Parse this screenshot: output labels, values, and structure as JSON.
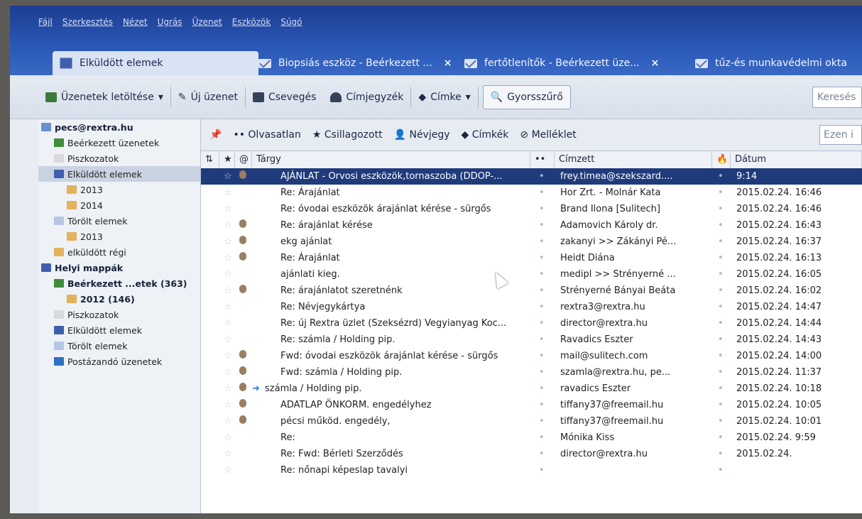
{
  "menu": [
    "Fájl",
    "Szerkesztés",
    "Nézet",
    "Ugrás",
    "Üzenet",
    "Eszközök",
    "Súgó"
  ],
  "tabs": [
    {
      "label": "Elküldött elemek",
      "closable": false
    },
    {
      "label": "Biopsiás eszköz - Beérkezett ...",
      "closable": true
    },
    {
      "label": "fertőtlenítők - Beérkezett üze...",
      "closable": true
    },
    {
      "label": "tűz-és munkavédelmi okta",
      "closable": false
    }
  ],
  "toolbar": {
    "get_messages": "Üzenetek letöltése",
    "new_message": "Új üzenet",
    "chat": "Csevegés",
    "address_book": "Címjegyzék",
    "tag": "Címke",
    "quick_filter": "Gyorsszűrő",
    "search_placeholder": "Keresés"
  },
  "sidebar": {
    "items": [
      {
        "label": "pecs@rextra.hu",
        "bold": true,
        "indent": 0
      },
      {
        "label": "Beérkezett üzenetek",
        "bold": false,
        "indent": 1
      },
      {
        "label": "Piszkozatok",
        "bold": false,
        "indent": 1
      },
      {
        "label": "Elküldött elemek",
        "bold": false,
        "indent": 1,
        "selected": true
      },
      {
        "label": "2013",
        "bold": false,
        "indent": 2
      },
      {
        "label": "2014",
        "bold": false,
        "indent": 2
      },
      {
        "label": "Törölt elemek",
        "bold": false,
        "indent": 1
      },
      {
        "label": "2013",
        "bold": false,
        "indent": 2
      },
      {
        "label": "elküldött régi",
        "bold": false,
        "indent": 1
      },
      {
        "label": "Helyi mappák",
        "bold": true,
        "indent": 0
      },
      {
        "label": "Beérkezett ...etek (363)",
        "bold": true,
        "indent": 1
      },
      {
        "label": "2012 (146)",
        "bold": true,
        "indent": 2
      },
      {
        "label": "Piszkozatok",
        "bold": false,
        "indent": 1
      },
      {
        "label": "Elküldött elemek",
        "bold": false,
        "indent": 1
      },
      {
        "label": "Törölt elemek",
        "bold": false,
        "indent": 1
      },
      {
        "label": "Postázandó üzenetek",
        "bold": false,
        "indent": 1
      }
    ]
  },
  "quickfilter": {
    "unread": "Olvasatlan",
    "starred": "Csillagozott",
    "contact": "Névjegy",
    "tags": "Címkék",
    "attachment": "Melléklet",
    "search_placeholder": "Ezen i"
  },
  "columns": {
    "subject": "Tárgy",
    "recipient": "Címzett",
    "date": "Dátum"
  },
  "messages": [
    {
      "subject": "AJÁNLAT - Orvosi eszközök,tornaszoba (DDOP-...",
      "recipient": "frey.timea@szekszard....",
      "date": "9:14",
      "attach": true,
      "selected": true
    },
    {
      "subject": "Re: Árajánlat",
      "recipient": "Hor Zrt. - Molnár Kata",
      "date": "2015.02.24. 16:46",
      "attach": false
    },
    {
      "subject": "Re: óvodai eszközök árajánlat kérése - sürgős",
      "recipient": "Brand Ilona [Sulitech]",
      "date": "2015.02.24. 16:46",
      "attach": false
    },
    {
      "subject": "Re: árajánlat kérése",
      "recipient": "Adamovich Károly dr.",
      "date": "2015.02.24. 16:43",
      "attach": true
    },
    {
      "subject": "ekg ajánlat",
      "recipient": "zakanyi >> Zákányi Pé...",
      "date": "2015.02.24. 16:37",
      "attach": true
    },
    {
      "subject": "Re: Árajánlat",
      "recipient": "Heidt Diána",
      "date": "2015.02.24. 16:13",
      "attach": true
    },
    {
      "subject": "ajánlati kieg.",
      "recipient": "medipl >> Strényerné ...",
      "date": "2015.02.24. 16:05",
      "attach": false
    },
    {
      "subject": "Re: árajánlatot szeretnénk",
      "recipient": "Strényerné Bányai Beáta",
      "date": "2015.02.24. 16:02",
      "attach": true
    },
    {
      "subject": "Re: Névjegykártya",
      "recipient": "rextra3@rextra.hu",
      "date": "2015.02.24. 14:47",
      "attach": false
    },
    {
      "subject": "Re: új Rextra üzlet (Szeksézrd) Vegyianyag Koc...",
      "recipient": "director@rextra.hu",
      "date": "2015.02.24. 14:44",
      "attach": false
    },
    {
      "subject": "Re: számla / Holding pip.",
      "recipient": "Ravadics Eszter",
      "date": "2015.02.24. 14:43",
      "attach": false
    },
    {
      "subject": "Fwd: óvodai eszközök árajánlat kérése - sürgős",
      "recipient": "mail@sulitech.com",
      "date": "2015.02.24. 14:00",
      "attach": true
    },
    {
      "subject": "Fwd: számla / Holding pip.",
      "recipient": "szamla@rextra.hu, pe...",
      "date": "2015.02.24. 11:37",
      "attach": true
    },
    {
      "subject": "számla / Holding pip.",
      "recipient": "ravadics Eszter",
      "date": "2015.02.24. 10:18",
      "attach": true,
      "forwarded": true
    },
    {
      "subject": "ADATLAP ÖNKORM. engedélyhez",
      "recipient": "tiffany37@freemail.hu",
      "date": "2015.02.24. 10:05",
      "attach": true
    },
    {
      "subject": "pécsi működ. engedély,",
      "recipient": "tiffany37@freemail.hu",
      "date": "2015.02.24. 10:01",
      "attach": true
    },
    {
      "subject": "Re:",
      "recipient": "Mónika Kiss",
      "date": "2015.02.24. 9:59",
      "attach": false
    },
    {
      "subject": "Re: Fwd: Bérleti Szerződés",
      "recipient": "director@rextra.hu",
      "date": "2015.02.24.",
      "attach": false
    },
    {
      "subject": "Re: nőnapi képeslap tavalyi",
      "recipient": "",
      "date": "",
      "attach": false
    }
  ],
  "colors": {
    "selection": "#1f3b7c",
    "titlebar": "#2a58b8"
  }
}
